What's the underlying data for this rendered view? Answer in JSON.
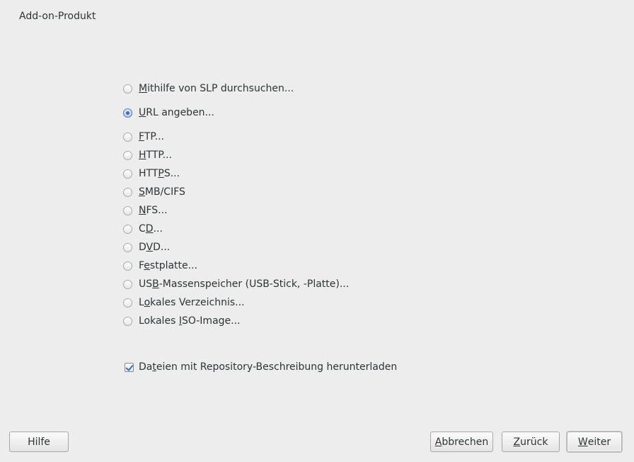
{
  "window": {
    "title": "Add-on-Produkt"
  },
  "options": [
    {
      "pre": "",
      "ul": "M",
      "post": "ithilfe von SLP durchsuchen...",
      "checked": false
    },
    {
      "pre": "",
      "ul": "U",
      "post": "RL angeben...",
      "checked": true
    },
    {
      "pre": "",
      "ul": "F",
      "post": "TP...",
      "checked": false
    },
    {
      "pre": "",
      "ul": "H",
      "post": "TTP...",
      "checked": false
    },
    {
      "pre": "HTT",
      "ul": "P",
      "post": "S...",
      "checked": false
    },
    {
      "pre": "",
      "ul": "S",
      "post": "MB/CIFS",
      "checked": false
    },
    {
      "pre": "",
      "ul": "N",
      "post": "FS...",
      "checked": false
    },
    {
      "pre": "C",
      "ul": "D",
      "post": "...",
      "checked": false
    },
    {
      "pre": "D",
      "ul": "V",
      "post": "D...",
      "checked": false
    },
    {
      "pre": "F",
      "ul": "e",
      "post": "stplatte...",
      "checked": false
    },
    {
      "pre": "US",
      "ul": "B",
      "post": "-Massenspeicher (USB-Stick, -Platte)...",
      "checked": false
    },
    {
      "pre": "L",
      "ul": "o",
      "post": "kales Verzeichnis...",
      "checked": false
    },
    {
      "pre": "Lokales ",
      "ul": "I",
      "post": "SO-Image...",
      "checked": false
    }
  ],
  "download_checkbox": {
    "pre": "Da",
    "ul": "t",
    "post": "eien mit Repository-Beschreibung herunterladen",
    "checked": true
  },
  "buttons": {
    "help": {
      "pre": "",
      "ul": "",
      "post": "Hilfe"
    },
    "cancel": {
      "pre": "",
      "ul": "A",
      "post": "bbrechen"
    },
    "back": {
      "pre": "",
      "ul": "Z",
      "post": "urück"
    },
    "next": {
      "pre": "",
      "ul": "W",
      "post": "eiter"
    }
  },
  "colors": {
    "background": "#ededed",
    "accent": "#3a6fb8"
  }
}
